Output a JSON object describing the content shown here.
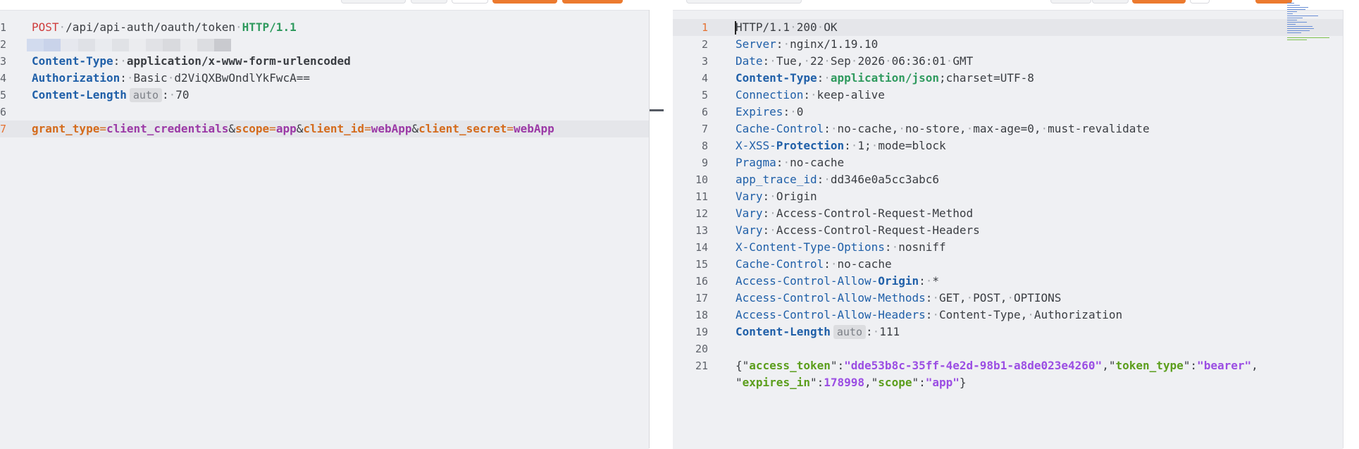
{
  "request": {
    "redacted_line_number": "2",
    "lines": [
      {
        "num": "1",
        "method": "POST",
        "path": "/api/api-auth/oauth/token",
        "protocol": "HTTP/1.1"
      },
      {
        "num": "3",
        "name": "Content-Type",
        "value": "application/x-www-form-urlencoded"
      },
      {
        "num": "4",
        "name": "Authorization",
        "value": "Basic d2ViQXBwOndlYkFwcA=="
      },
      {
        "num": "5",
        "name": "Content-Length",
        "badge": "auto",
        "value": "70"
      },
      {
        "num": "6"
      },
      {
        "num": "7"
      }
    ],
    "body_params": [
      {
        "key": "grant_type",
        "value": "client_credentials"
      },
      {
        "key": "scope",
        "value": "app"
      },
      {
        "key": "client_id",
        "value": "webApp"
      },
      {
        "key": "client_secret",
        "value": "webApp"
      }
    ]
  },
  "response": {
    "status_line": {
      "num": "1",
      "text": "HTTP/1.1 200 OK"
    },
    "headers": [
      {
        "num": "2",
        "name": "Server",
        "value": "nginx/1.19.10"
      },
      {
        "num": "3",
        "name": "Date",
        "value": "Tue, 22 Sep 2026 06:36:01 GMT"
      },
      {
        "num": "4",
        "name": "Content-Type",
        "value_main": "application/json",
        "value_tail": ";charset=UTF-8"
      },
      {
        "num": "5",
        "name": "Connection",
        "value": "keep-alive"
      },
      {
        "num": "6",
        "name": "Expires",
        "value": "0"
      },
      {
        "num": "7",
        "name": "Cache-Control",
        "value": "no-cache, no-store, max-age=0, must-revalidate"
      },
      {
        "num": "8",
        "name_a": "X-XSS-",
        "name_b": "Protection",
        "value": "1; mode=block"
      },
      {
        "num": "9",
        "name": "Pragma",
        "value": "no-cache"
      },
      {
        "num": "10",
        "name": "app_trace_id",
        "value": "dd346e0a5cc3abc6"
      },
      {
        "num": "11",
        "name": "Vary",
        "value": "Origin"
      },
      {
        "num": "12",
        "name": "Vary",
        "value": "Access-Control-Request-Method"
      },
      {
        "num": "13",
        "name": "Vary",
        "value": "Access-Control-Request-Headers"
      },
      {
        "num": "14",
        "name": "X-Content-Type-Options",
        "value": "nosniff"
      },
      {
        "num": "15",
        "name": "Cache-Control",
        "value": "no-cache"
      },
      {
        "num": "16",
        "name_a": "Access-Control-Allow-",
        "name_b": "Origin",
        "value": "*"
      },
      {
        "num": "17",
        "name": "Access-Control-Allow-Methods",
        "value": "GET, POST, OPTIONS"
      },
      {
        "num": "18",
        "name": "Access-Control-Allow-Headers",
        "value": "Content-Type, Authorization"
      },
      {
        "num": "19",
        "name": "Content-Length",
        "badge": "auto",
        "value": "111"
      }
    ],
    "blank_line_num": "20",
    "body_line_num": "21",
    "json": {
      "k_access_token": "access_token",
      "v_access_token": "dde53b8c-35ff-4e2d-98b1-a8de023e4260",
      "k_token_type": "token_type",
      "v_token_type": "bearer",
      "k_expires_in": "expires_in",
      "v_expires_in": "178998",
      "k_scope": "scope",
      "v_scope": "app"
    }
  },
  "colors": {
    "accent_orange": "#ec7a2f",
    "header_name_blue": "#1f5fa8",
    "method_red": "#cf3d3d",
    "protocol_green": "#2f9a5e",
    "param_orange": "#d46b1c",
    "param_purple": "#9b39a6",
    "json_key_green": "#5b9e1c",
    "json_value_purple": "#9b4ee3"
  },
  "icons": [
    "minimap"
  ]
}
